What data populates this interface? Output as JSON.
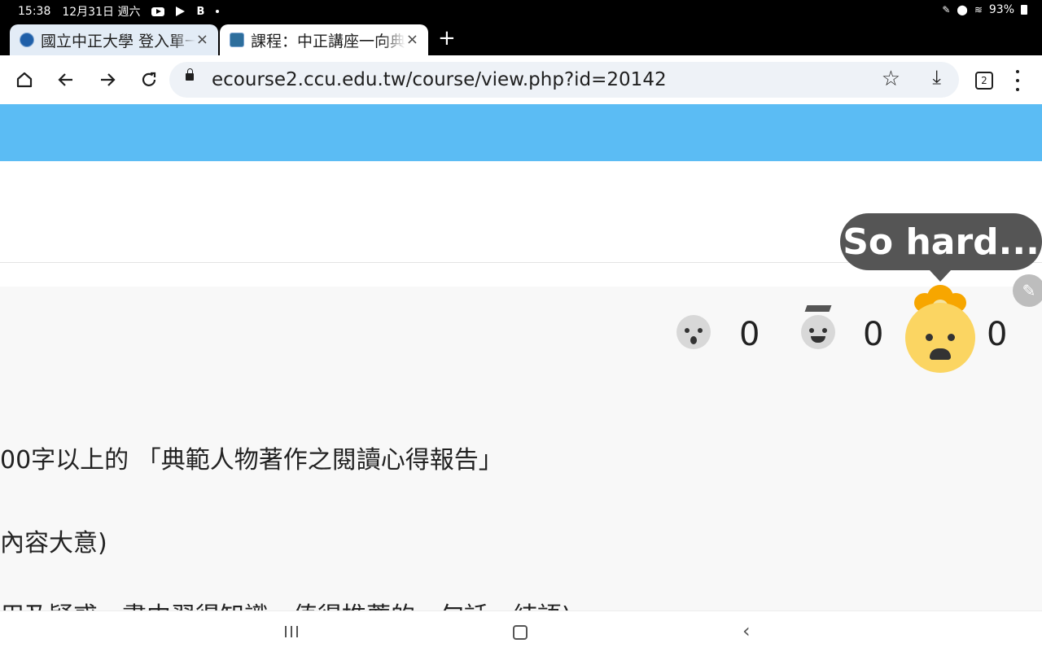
{
  "status_bar": {
    "time": "15:38",
    "date": "12月31日 週六",
    "battery": "93%"
  },
  "tabs": [
    {
      "title": "國立中正大學 登入單一入口",
      "close": "×"
    },
    {
      "title": "課程：中正講座一向典範學習",
      "close": "×"
    }
  ],
  "new_tab_label": "+",
  "toolbar": {
    "url": "ecourse2.ccu.edu.tw/course/view.php?id=20142",
    "tab_count": "2"
  },
  "reactions": [
    {
      "icon": "surprised-face-icon",
      "count": "0"
    },
    {
      "icon": "graduate-face-icon",
      "count": "0"
    },
    {
      "icon": "exploding-head-icon",
      "count": "0"
    }
  ],
  "tooltip": "So hard...",
  "content_lines": [
    "00字以上的 「典範人物著作之閱讀心得報告」",
    "內容大意)",
    "用及疑惑、書中習得知識、值得推薦的一句話、結語)"
  ],
  "colors": {
    "banner": "#5bbcf4",
    "tooltip": "#555555",
    "emoji": "#fbd562"
  }
}
